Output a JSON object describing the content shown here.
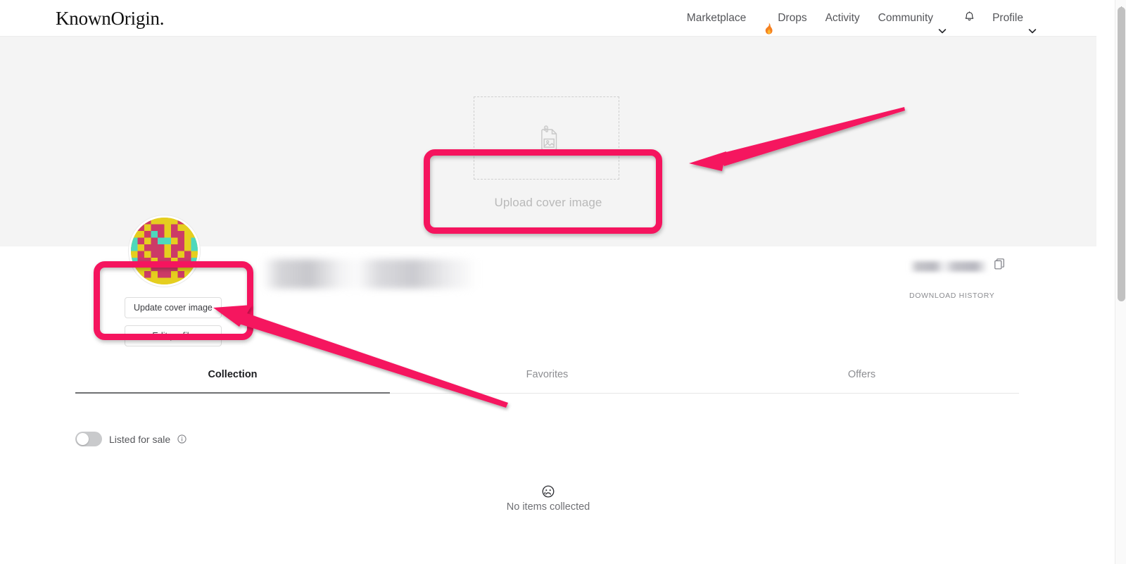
{
  "brand": {
    "logo": "KnownOrigin."
  },
  "nav": {
    "items": [
      {
        "label": "Marketplace",
        "icon": null,
        "chevron": false
      },
      {
        "label": "Drops",
        "icon": "flame-icon",
        "chevron": false
      },
      {
        "label": "Activity",
        "icon": null,
        "chevron": false
      },
      {
        "label": "Community",
        "icon": null,
        "chevron": true
      }
    ],
    "notifications_icon": "bell-icon",
    "profile": {
      "label": "Profile",
      "chevron": true
    }
  },
  "cover": {
    "dropzone_icon": "image-attachment-icon",
    "upload_label": "Upload cover image"
  },
  "profile": {
    "avatar_icon": "pixel-avatar",
    "display_name": "",
    "display_name_redacted": true,
    "update_cover_label": "Update cover image",
    "edit_profile_label": "Edit profile",
    "wallet_address": "",
    "wallet_address_redacted": true,
    "copy_icon": "copy-icon",
    "download_history_label": "DOWNLOAD HISTORY"
  },
  "tabs": [
    {
      "label": "Collection",
      "active": true
    },
    {
      "label": "Favorites",
      "active": false
    },
    {
      "label": "Offers",
      "active": false
    }
  ],
  "filters": {
    "listed_for_sale_label": "Listed for sale",
    "listed_for_sale_on": false,
    "info_icon": "info-icon"
  },
  "empty_state": {
    "icon": "sad-face-icon",
    "icon_glyph": "☹",
    "message": "No items collected"
  },
  "annotations": {
    "accent_color": "#F5145E",
    "highlight_boxes": [
      {
        "name": "upload-cover-image-highlight"
      },
      {
        "name": "update-cover-image-highlight"
      }
    ],
    "arrows": [
      {
        "name": "arrow-to-upload-cover-image"
      },
      {
        "name": "arrow-to-update-cover-image"
      }
    ]
  },
  "colors": {
    "cover_bg": "#f4f4f4",
    "page_bg": "#ffffff",
    "avatar_yellow": "#e5ce1f",
    "avatar_pink": "#cc3a67",
    "avatar_teal": "#4ed8bc"
  }
}
